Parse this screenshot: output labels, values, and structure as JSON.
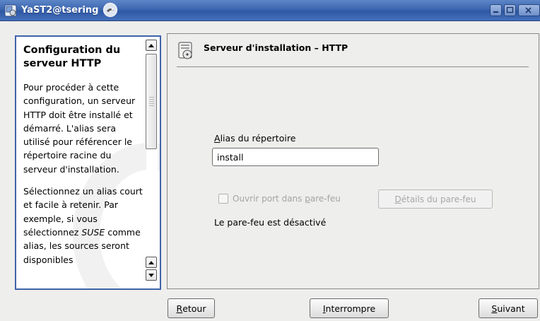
{
  "window": {
    "title": "YaST2@tsering",
    "controls": [
      "minimize",
      "maximize",
      "close"
    ]
  },
  "help": {
    "title": "Configuration du serveur HTTP",
    "paragraph1": "Pour procéder à cette configuration, un serveur HTTP doit être installé et démarré. L'alias sera utilisé pour référencer le répertoire racine du serveur d'installation.",
    "paragraph2_before": "Sélectionnez un alias court et facile à retenir. Par exemple, si vous sélectionnez ",
    "paragraph2_em": "SUSE",
    "paragraph2_after": " comme alias, les sources seront disponibles"
  },
  "dialog": {
    "title": "Serveur d'installation – HTTP",
    "alias_label_accel": "A",
    "alias_label_rest": "lias du répertoire",
    "alias_value": "install",
    "firewall_checkbox_before": "Ouvrir port dans ",
    "firewall_checkbox_accel": "p",
    "firewall_checkbox_after": "are-feu",
    "firewall_checked": false,
    "firewall_details_accel": "D",
    "firewall_details_rest": "étails du pare-feu",
    "firewall_status": "Le pare-feu est désactivé"
  },
  "buttons": {
    "back_accel": "R",
    "back_rest": "etour",
    "abort_accel": "I",
    "abort_rest": "nterrompre",
    "next_accel": "S",
    "next_rest": "uivant"
  },
  "colors": {
    "titlebar": "#3c66b0",
    "help_border": "#3d64aa",
    "window_bg": "#eeeeec"
  }
}
